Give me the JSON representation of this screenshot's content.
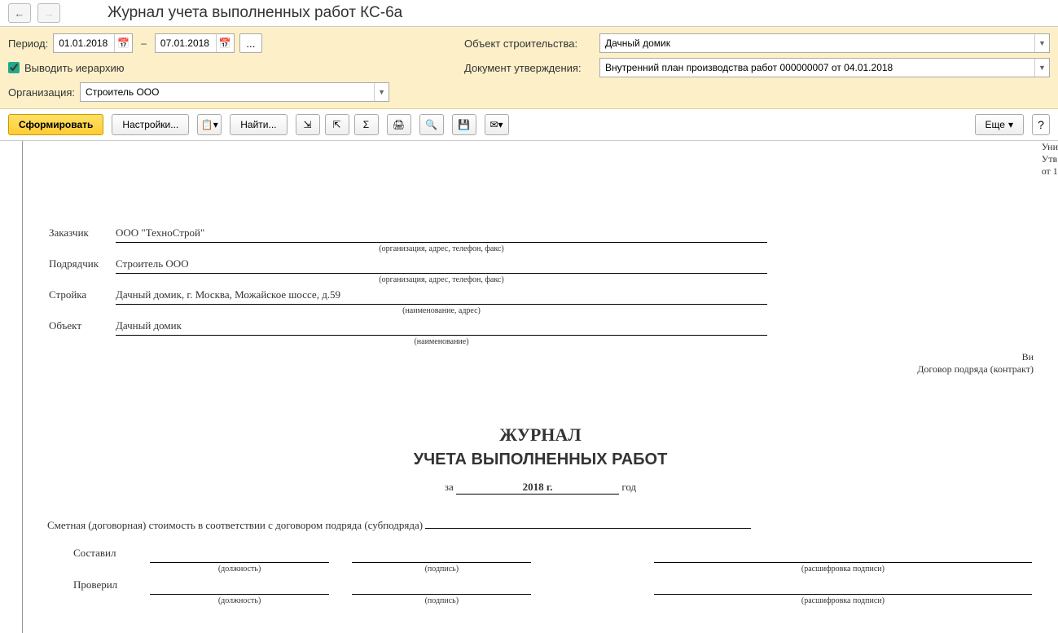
{
  "header": {
    "title": "Журнал учета выполненных работ КС-6а"
  },
  "filters": {
    "period_label": "Период:",
    "date_from": "01.01.2018",
    "date_to": "07.01.2018",
    "hierarchy_label": "Выводить иерархию",
    "hierarchy_checked": true,
    "org_label": "Организация:",
    "org_value": "Строитель ООО",
    "object_label": "Объект строительства:",
    "object_value": "Дачный домик",
    "approval_label": "Документ утверждения:",
    "approval_value": "Внутренний план производства работ 000000007 от 04.01.2018"
  },
  "toolbar": {
    "generate": "Сформировать",
    "settings": "Настройки...",
    "find": "Найти...",
    "more": "Еще",
    "help": "?"
  },
  "document": {
    "rt1": "Уни",
    "rt2": "Утв",
    "rt3": "от 1",
    "customer_label": "Заказчик",
    "customer_value": "ООО \"ТехноСтрой\"",
    "contractor_label": "Подрядчик",
    "contractor_value": "Строитель ООО",
    "site_label": "Стройка",
    "site_value": "Дачный домик, г. Москва, Можайское шоссе, д.59",
    "obj_label": "Объект",
    "obj_value": "Дачный домик",
    "hint_org": "(организация, адрес, телефон, факс)",
    "hint_name_addr": "(наименование, адрес)",
    "hint_name": "(наименование)",
    "right_vi": "Ви",
    "right_contract": "Договор подряда (контракт)",
    "title1": "ЖУРНАЛ",
    "title2": "УЧЕТА ВЫПОЛНЕННЫХ РАБОТ",
    "year_prefix": "за",
    "year_value": "2018 г.",
    "year_suffix": "год",
    "smet_text": "Сметная (договорная) стоимость в соответствии с договором подряда (субподряда)",
    "compiled": "Составил",
    "checked": "Проверил",
    "hint_position": "(должность)",
    "hint_signature": "(подпись)",
    "hint_fullname": "(расшифровка подписи)"
  }
}
